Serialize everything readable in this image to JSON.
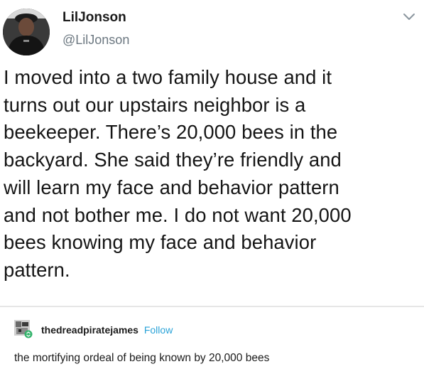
{
  "tweet": {
    "display_name": "LilJonson",
    "handle": "@LilJonson",
    "text_lines": [
      "I moved into a two family house and it",
      "turns out our upstairs neighbor is a",
      "beekeeper. There’s 20,000 bees in the",
      "backyard. She said they’re friendly and",
      "will learn my face and behavior pattern",
      "and not bother me. I do not want 20,000",
      "bees knowing my face and behavior",
      "pattern."
    ],
    "menu_icon": "chevron-down-icon"
  },
  "reblog": {
    "username": "thedreadpiratejames",
    "follow_label": "Follow",
    "comment": "the mortifying ordeal of being known by 20,000 bees",
    "link_color": "#2aa3d8"
  }
}
